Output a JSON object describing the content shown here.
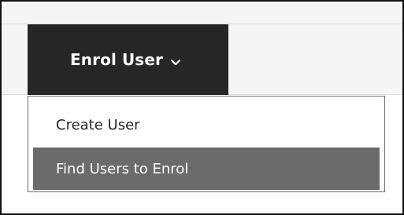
{
  "enrol_menu": {
    "button_label": "Enrol User",
    "button_icon": "chevron-down-icon",
    "items": [
      {
        "label": "Create User",
        "state": "default"
      },
      {
        "label": "Find Users to Enrol",
        "state": "highlighted"
      }
    ]
  },
  "colors": {
    "button_background": "#262626",
    "highlight_background": "#6b6b6b",
    "text": "#262626",
    "inverse_text": "#ffffff",
    "border": "#111111"
  }
}
